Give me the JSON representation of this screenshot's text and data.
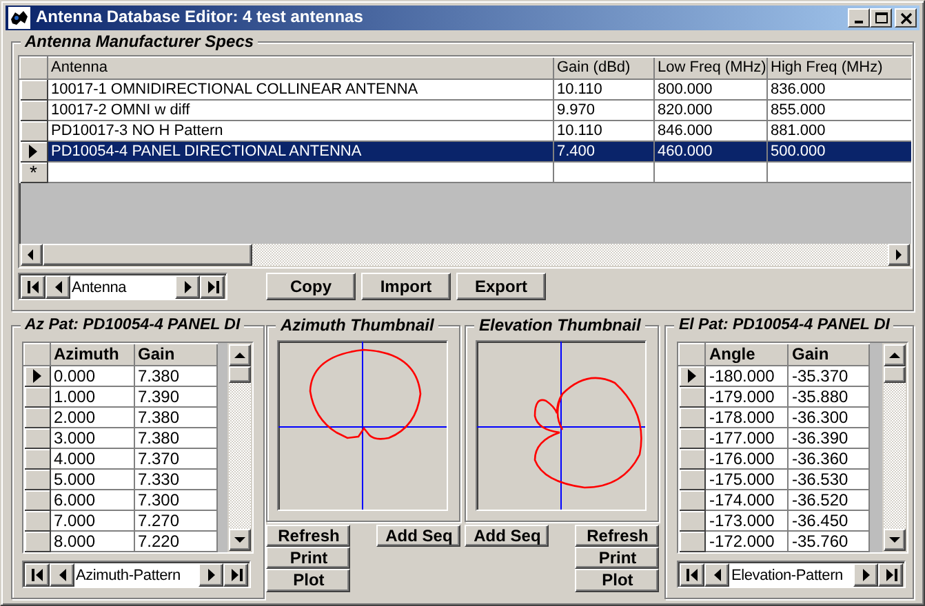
{
  "window": {
    "title": "Antenna Database Editor: 4 test antennas"
  },
  "specs": {
    "legend": "Antenna Manufacturer Specs",
    "columns": [
      "Antenna",
      "Gain (dBd)",
      "Low Freq (MHz)",
      "High Freq (MHz)"
    ],
    "rows": [
      {
        "cells": [
          "10017-1 OMNIDIRECTIONAL COLLINEAR ANTENNA",
          "10.110",
          "800.000",
          "836.000"
        ],
        "selected": false
      },
      {
        "cells": [
          "10017-2 OMNI w diff",
          "9.970",
          "820.000",
          "855.000"
        ],
        "selected": false
      },
      {
        "cells": [
          "PD10017-3 NO H Pattern",
          "10.110",
          "846.000",
          "881.000"
        ],
        "selected": false
      },
      {
        "cells": [
          "PD10054-4 PANEL DIRECTIONAL ANTENNA",
          "7.400",
          "460.000",
          "500.000"
        ],
        "selected": true
      }
    ],
    "new_row": {
      "marker": "*"
    },
    "navigator": {
      "label": "Antenna"
    },
    "buttons": [
      "Copy",
      "Import",
      "Export"
    ]
  },
  "az_pattern": {
    "legend": "Az Pat: PD10054-4 PANEL DI",
    "columns": [
      "Azimuth",
      "Gain"
    ],
    "rows": [
      {
        "cells": [
          "0.000",
          "7.380"
        ],
        "selected": true
      },
      {
        "cells": [
          "1.000",
          "7.390"
        ],
        "selected": false
      },
      {
        "cells": [
          "2.000",
          "7.380"
        ],
        "selected": false
      },
      {
        "cells": [
          "3.000",
          "7.380"
        ],
        "selected": false
      },
      {
        "cells": [
          "4.000",
          "7.370"
        ],
        "selected": false
      },
      {
        "cells": [
          "5.000",
          "7.330"
        ],
        "selected": false
      },
      {
        "cells": [
          "6.000",
          "7.300"
        ],
        "selected": false
      },
      {
        "cells": [
          "7.000",
          "7.270"
        ],
        "selected": false
      },
      {
        "cells": [
          "8.000",
          "7.220"
        ],
        "selected": false
      }
    ],
    "navigator": {
      "label": "Azimuth-Pattern"
    }
  },
  "az_thumbnail": {
    "title": "Azimuth Thumbnail",
    "buttons": [
      "Refresh",
      "Print",
      "Plot"
    ],
    "add_button": "Add Seq"
  },
  "el_thumbnail": {
    "title": "Elevation Thumbnail",
    "buttons": [
      "Refresh",
      "Print",
      "Plot"
    ],
    "add_button": "Add Seq"
  },
  "el_pattern": {
    "legend": "El Pat: PD10054-4 PANEL DI",
    "columns": [
      "Angle",
      "Gain"
    ],
    "rows": [
      {
        "cells": [
          "-180.000",
          "-35.370"
        ],
        "selected": true
      },
      {
        "cells": [
          "-179.000",
          "-35.880"
        ],
        "selected": false
      },
      {
        "cells": [
          "-178.000",
          "-36.300"
        ],
        "selected": false
      },
      {
        "cells": [
          "-177.000",
          "-36.390"
        ],
        "selected": false
      },
      {
        "cells": [
          "-176.000",
          "-36.360"
        ],
        "selected": false
      },
      {
        "cells": [
          "-175.000",
          "-36.530"
        ],
        "selected": false
      },
      {
        "cells": [
          "-174.000",
          "-36.520"
        ],
        "selected": false
      },
      {
        "cells": [
          "-173.000",
          "-36.450"
        ],
        "selected": false
      },
      {
        "cells": [
          "-172.000",
          "-35.760"
        ],
        "selected": false
      }
    ],
    "navigator": {
      "label": "Elevation-Pattern"
    }
  }
}
